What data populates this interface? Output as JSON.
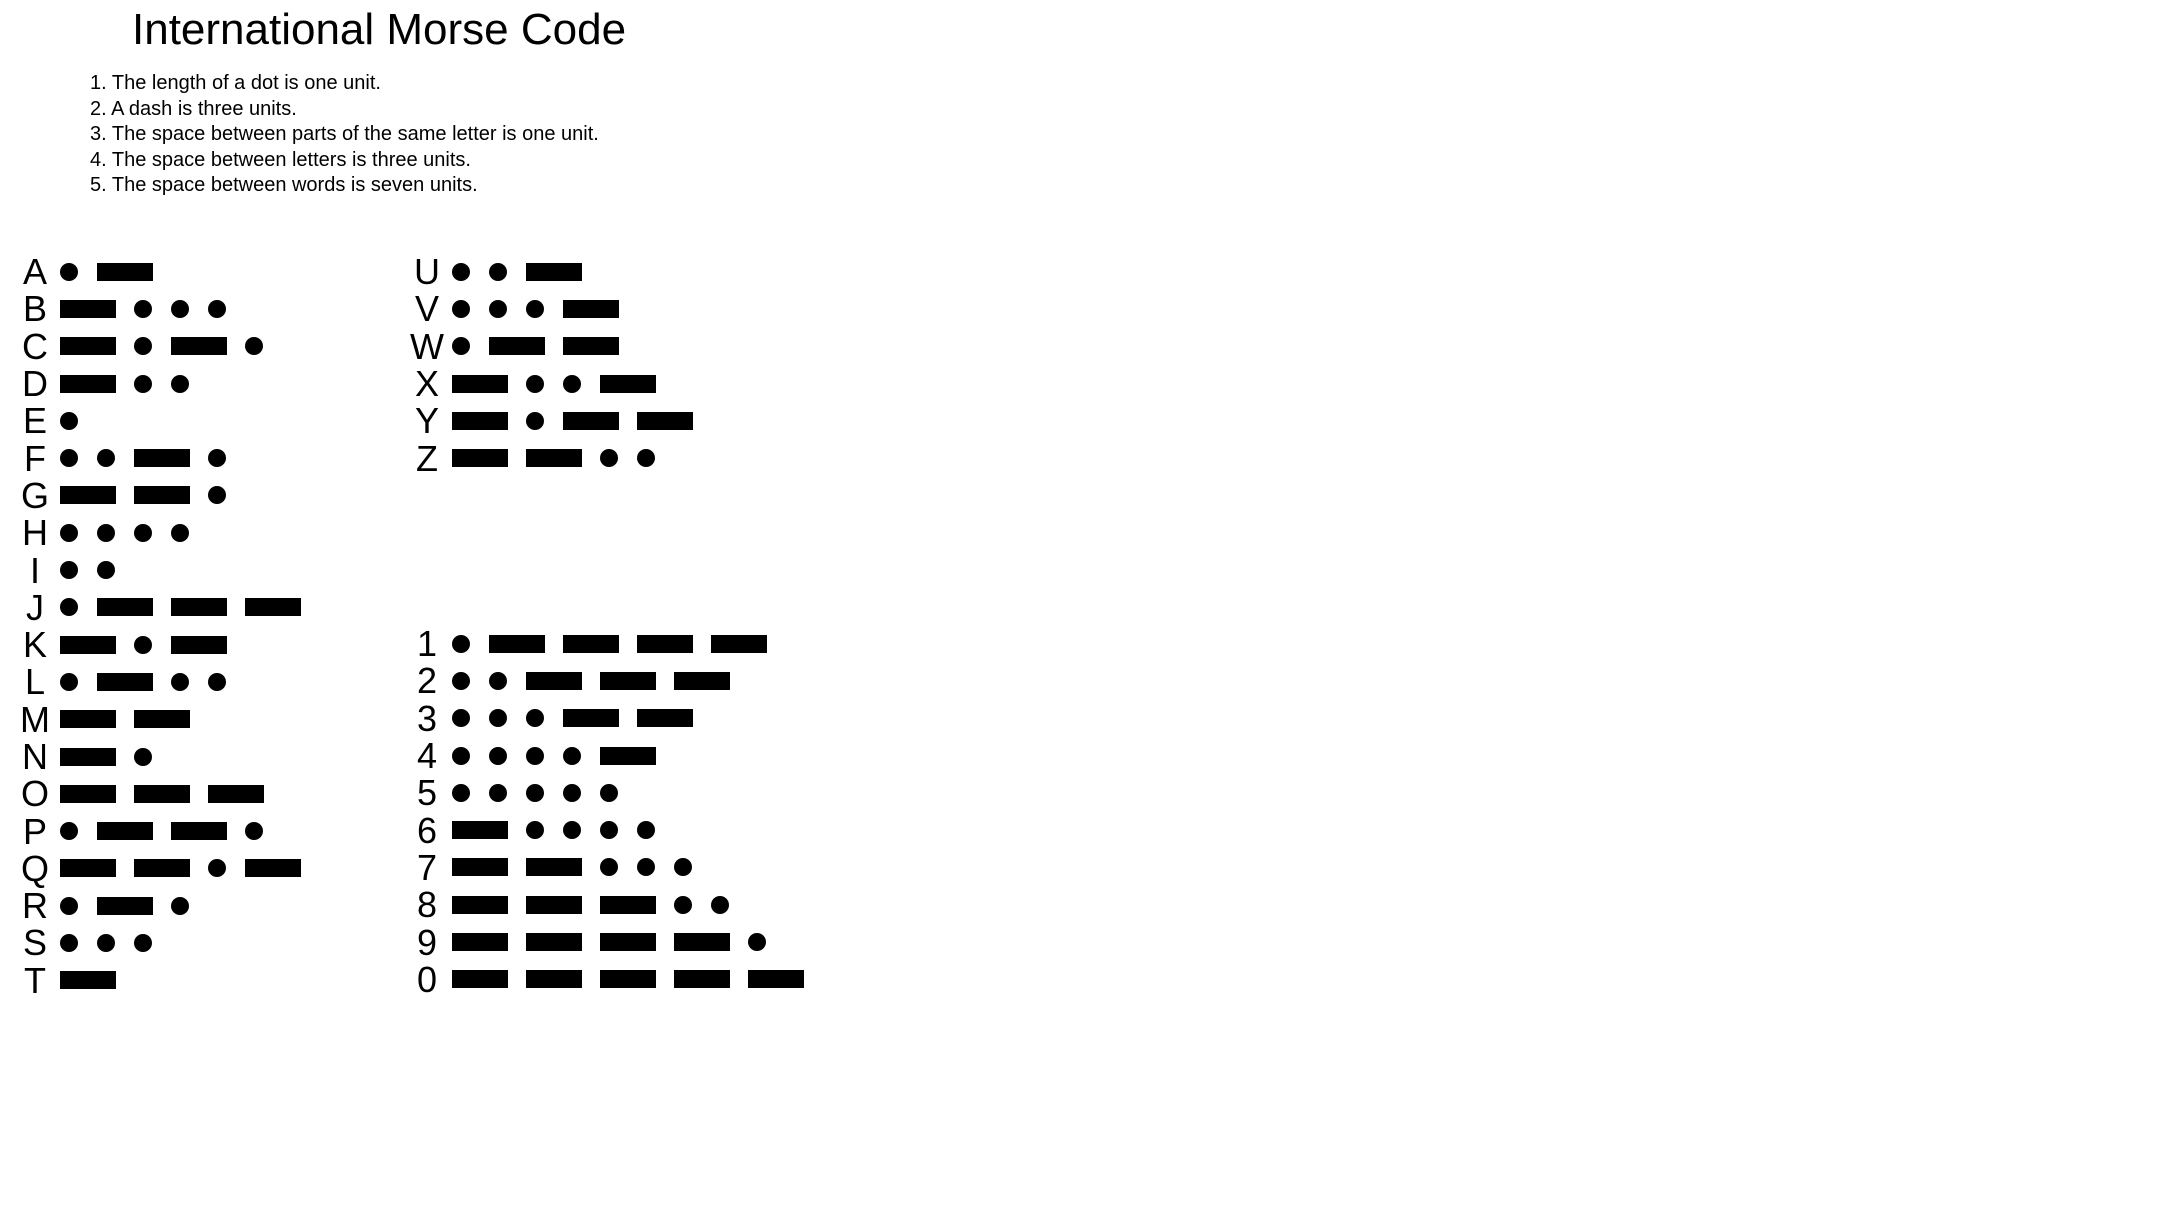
{
  "title": "International Morse Code",
  "rules": [
    "1. The length of a dot is one unit.",
    "2. A dash is three units.",
    "3. The space between parts of the same letter is one unit.",
    "4. The space between letters is three units.",
    "5. The space between words is seven units."
  ],
  "letters_a_to_t": [
    {
      "char": "A",
      "code": ".-"
    },
    {
      "char": "B",
      "code": "-..."
    },
    {
      "char": "C",
      "code": "-.-."
    },
    {
      "char": "D",
      "code": "-.."
    },
    {
      "char": "E",
      "code": "."
    },
    {
      "char": "F",
      "code": "..-."
    },
    {
      "char": "G",
      "code": "--."
    },
    {
      "char": "H",
      "code": "...."
    },
    {
      "char": "I",
      "code": ".."
    },
    {
      "char": "J",
      "code": ".---"
    },
    {
      "char": "K",
      "code": "-.-"
    },
    {
      "char": "L",
      "code": ".-.."
    },
    {
      "char": "M",
      "code": "--"
    },
    {
      "char": "N",
      "code": "-."
    },
    {
      "char": "O",
      "code": "---"
    },
    {
      "char": "P",
      "code": ".--."
    },
    {
      "char": "Q",
      "code": "--.-"
    },
    {
      "char": "R",
      "code": ".-."
    },
    {
      "char": "S",
      "code": "..."
    },
    {
      "char": "T",
      "code": "-"
    }
  ],
  "letters_u_to_z": [
    {
      "char": "U",
      "code": "..-"
    },
    {
      "char": "V",
      "code": "...-"
    },
    {
      "char": "W",
      "code": ".--"
    },
    {
      "char": "X",
      "code": "-..-"
    },
    {
      "char": "Y",
      "code": "-.--"
    },
    {
      "char": "Z",
      "code": "--.."
    }
  ],
  "digits": [
    {
      "char": "1",
      "code": ".----"
    },
    {
      "char": "2",
      "code": "..---"
    },
    {
      "char": "3",
      "code": "...--"
    },
    {
      "char": "4",
      "code": "....-"
    },
    {
      "char": "5",
      "code": "....."
    },
    {
      "char": "6",
      "code": "-...."
    },
    {
      "char": "7",
      "code": "--..."
    },
    {
      "char": "8",
      "code": "---.."
    },
    {
      "char": "9",
      "code": "----."
    },
    {
      "char": "0",
      "code": "-----"
    }
  ]
}
